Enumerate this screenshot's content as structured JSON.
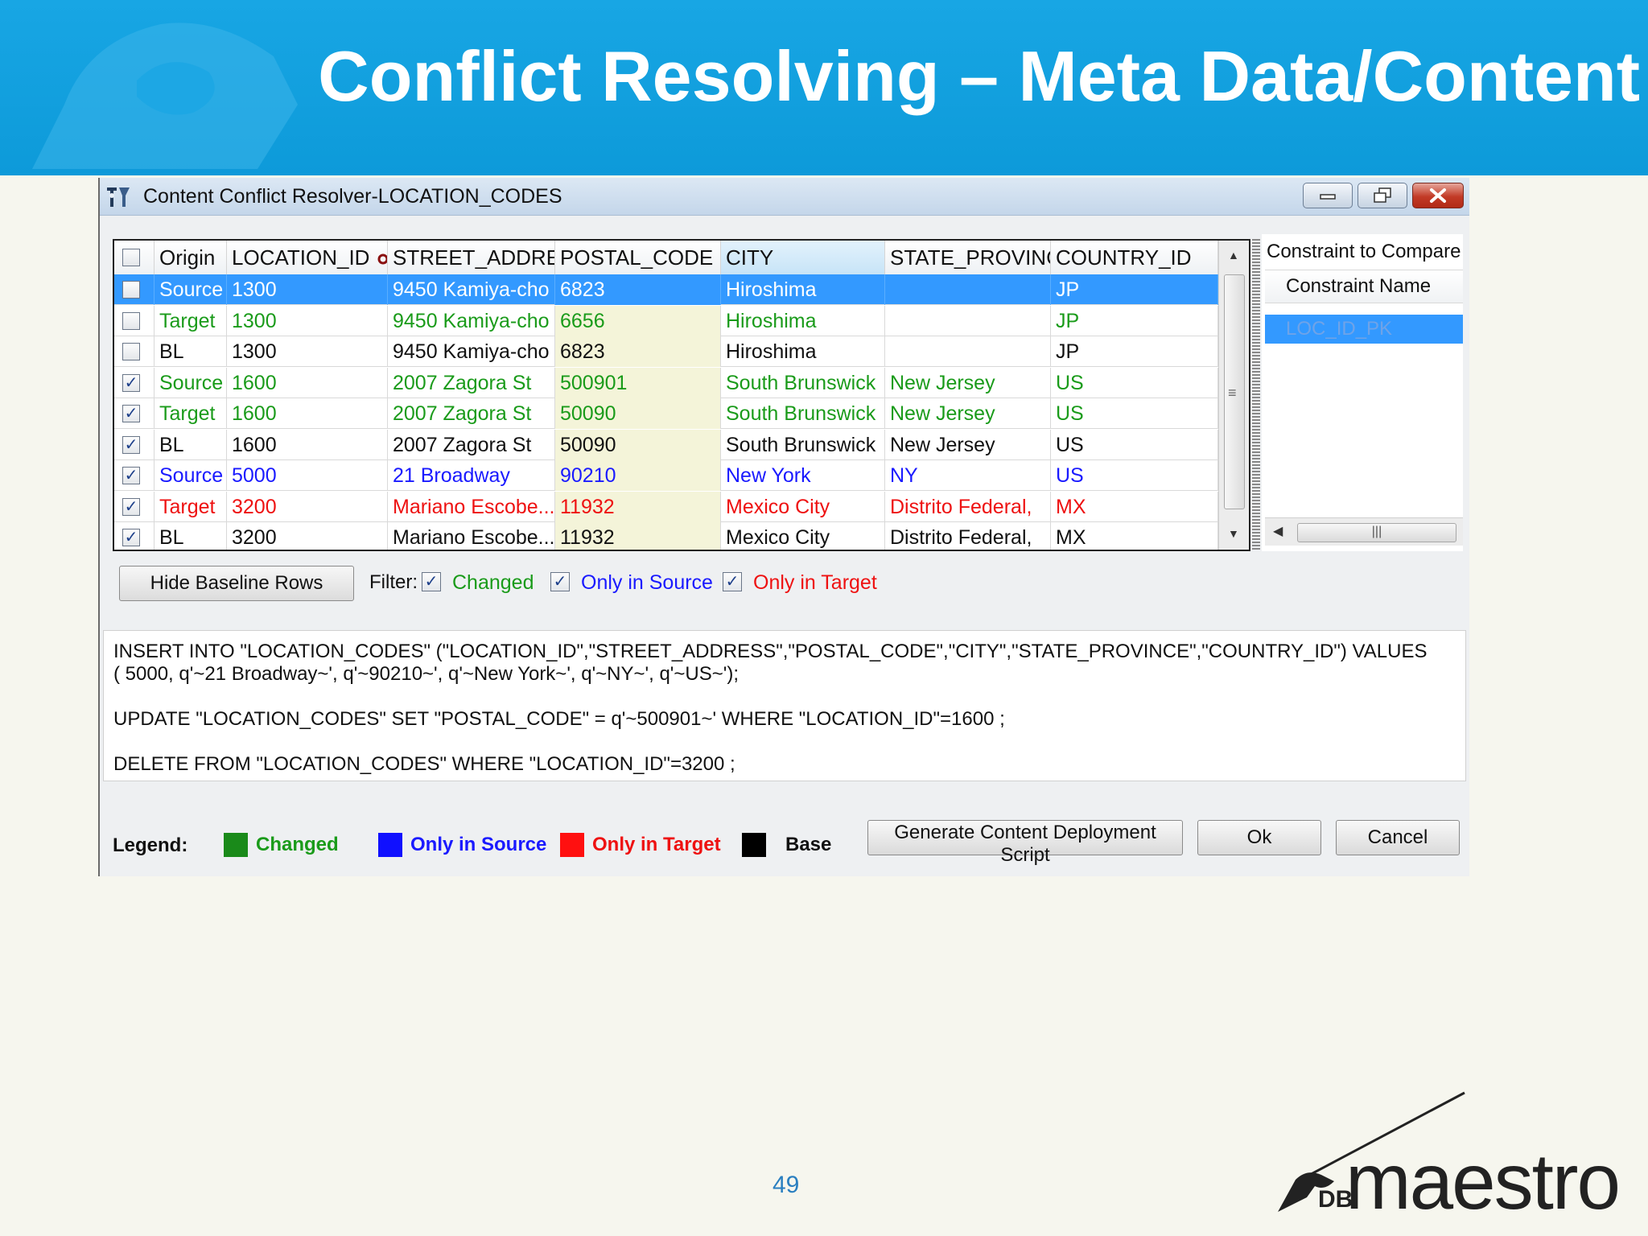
{
  "slide": {
    "title": "Conflict Resolving – Meta Data/Content",
    "page_number": "49",
    "logo": {
      "prefix": "DB",
      "word": "maestro"
    }
  },
  "window": {
    "title": "Content Conflict Resolver-LOCATION_CODES",
    "controls": [
      "minimize-icon",
      "restore-icon",
      "close-icon"
    ]
  },
  "grid": {
    "columns": [
      "Origin",
      "LOCATION_ID",
      "STREET_ADDRE",
      "POSTAL_CODE",
      "CITY",
      "STATE_PROVINC",
      "COUNTRY_ID"
    ],
    "key_column_icon": "key-icon",
    "sorted_column": "CITY",
    "rows": [
      {
        "checked": false,
        "selected": true,
        "color": "#1a9b1a",
        "cells": [
          "Source",
          "1300",
          "9450 Kamiya-cho",
          "6823",
          "Hiroshima",
          "",
          "JP"
        ]
      },
      {
        "checked": false,
        "selected": false,
        "color": "#1a9b1a",
        "cells": [
          "Target",
          "1300",
          "9450 Kamiya-cho",
          "6656",
          "Hiroshima",
          "",
          "JP"
        ]
      },
      {
        "checked": false,
        "selected": false,
        "color": "#111111",
        "cells": [
          "BL",
          "1300",
          "9450 Kamiya-cho",
          "6823",
          "Hiroshima",
          "",
          "JP"
        ]
      },
      {
        "checked": true,
        "selected": false,
        "color": "#1a9b1a",
        "cells": [
          "Source",
          "1600",
          "2007 Zagora St",
          "500901",
          "South Brunswick",
          "New Jersey",
          "US"
        ]
      },
      {
        "checked": true,
        "selected": false,
        "color": "#1a9b1a",
        "cells": [
          "Target",
          "1600",
          "2007 Zagora St",
          "50090",
          "South Brunswick",
          "New Jersey",
          "US"
        ]
      },
      {
        "checked": true,
        "selected": false,
        "color": "#111111",
        "cells": [
          "BL",
          "1600",
          "2007 Zagora St",
          "50090",
          "South Brunswick",
          "New Jersey",
          "US"
        ]
      },
      {
        "checked": true,
        "selected": false,
        "color": "#1a1aff",
        "cells": [
          "Source",
          "5000",
          "21 Broadway",
          "90210",
          "New York",
          "NY",
          "US"
        ]
      },
      {
        "checked": true,
        "selected": false,
        "color": "#ee1111",
        "cells": [
          "Target",
          "3200",
          "Mariano Escobe...",
          "11932",
          "Mexico City",
          "Distrito Federal,",
          "MX"
        ]
      },
      {
        "checked": true,
        "selected": false,
        "color": "#111111",
        "cells": [
          "BL",
          "3200",
          "Mariano Escobe...",
          "11932",
          "Mexico City",
          "Distrito Federal,",
          "MX"
        ]
      }
    ]
  },
  "constraints": {
    "title": "Constraint to Compare",
    "header": "Constraint Name",
    "items": [
      "LOC_ID_PK"
    ]
  },
  "filter": {
    "hide_button": "Hide Baseline Rows",
    "label": "Filter:",
    "options": [
      {
        "label": "Changed",
        "checked": true,
        "color": "#1a9b1a"
      },
      {
        "label": "Only in Source",
        "checked": true,
        "color": "#1a1aff"
      },
      {
        "label": "Only in Target",
        "checked": true,
        "color": "#ee1111"
      }
    ]
  },
  "script": {
    "lines": [
      "INSERT INTO \"LOCATION_CODES\" (\"LOCATION_ID\",\"STREET_ADDRESS\",\"POSTAL_CODE\",\"CITY\",\"STATE_PROVINCE\",\"COUNTRY_ID\") VALUES",
      "( 5000, q'~21 Broadway~', q'~90210~', q'~New York~', q'~NY~', q'~US~');",
      "UPDATE \"LOCATION_CODES\" SET \"POSTAL_CODE\" = q'~500901~' WHERE  \"LOCATION_ID\"=1600 ;",
      "DELETE FROM \"LOCATION_CODES\" WHERE  \"LOCATION_ID\"=3200 ;"
    ]
  },
  "legend": {
    "label": "Legend:",
    "items": [
      {
        "label": "Changed",
        "color": "#1a8a1a"
      },
      {
        "label": "Only in Source",
        "color": "#1010ff"
      },
      {
        "label": "Only in Target",
        "color": "#ff1010"
      },
      {
        "label": "Base",
        "color": "#000000"
      }
    ]
  },
  "buttons": {
    "generate": "Generate Content Deployment Script",
    "ok": "Ok",
    "cancel": "Cancel"
  }
}
